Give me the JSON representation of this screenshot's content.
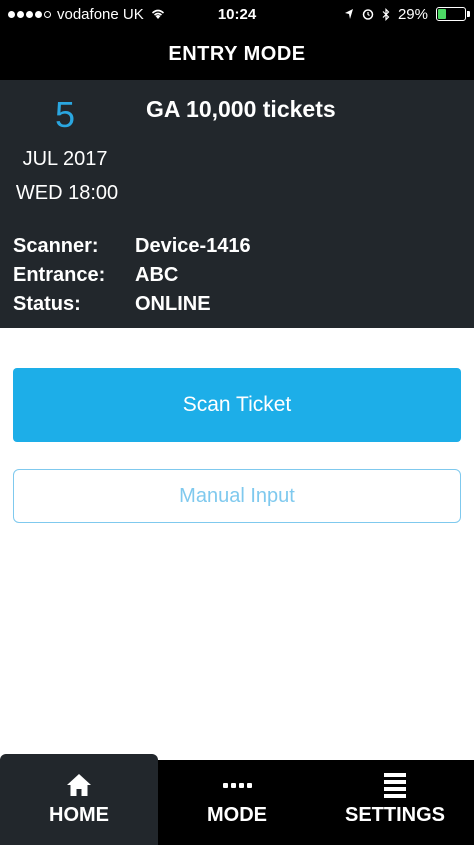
{
  "status_bar": {
    "carrier": "vodafone UK",
    "time": "10:24",
    "battery": "29%",
    "battery_level": 0.29,
    "icons": [
      "signal-dots",
      "wifi-icon",
      "location-icon",
      "alarm-icon",
      "bluetooth-icon",
      "battery-icon"
    ]
  },
  "nav": {
    "title": "ENTRY MODE"
  },
  "event": {
    "day": "5",
    "month_year": "JUL 2017",
    "weekday_time": "WED 18:00",
    "title": "GA 10,000 tickets",
    "info": [
      {
        "label": "Scanner:",
        "value": "Device-1416"
      },
      {
        "label": "Entrance:",
        "value": "ABC"
      },
      {
        "label": "Status:",
        "value": "ONLINE"
      }
    ]
  },
  "actions": {
    "scan_label": "Scan Ticket",
    "manual_label": "Manual Input"
  },
  "tabs": [
    {
      "label": "HOME",
      "icon": "home-icon",
      "active": true
    },
    {
      "label": "MODE",
      "icon": "dots-icon",
      "active": false
    },
    {
      "label": "SETTINGS",
      "icon": "list-icon",
      "active": false
    }
  ],
  "colors": {
    "accent": "#1daee8",
    "day_number": "#2aa6e0",
    "panel_bg": "#22272c",
    "bar_bg": "#000000",
    "battery": "#4cd964"
  }
}
